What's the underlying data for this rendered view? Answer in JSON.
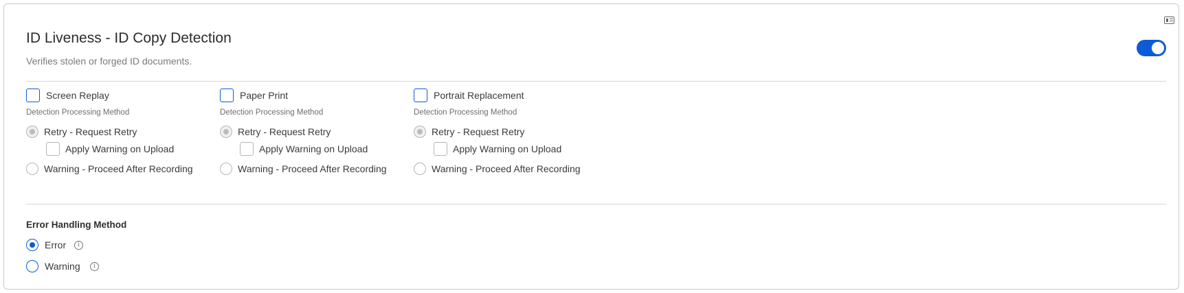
{
  "card": {
    "title": "ID Liveness - ID Copy Detection",
    "subtitle": "Verifies stolen or forged ID documents.",
    "enabled": true,
    "icon": "id-card-icon"
  },
  "detections": [
    {
      "label": "Screen Replay",
      "checked": false,
      "method_label": "Detection Processing Method",
      "retry_label": "Retry - Request Retry",
      "apply_warning_label": "Apply Warning on Upload",
      "warning_label": "Warning - Proceed After Recording"
    },
    {
      "label": "Paper Print",
      "checked": false,
      "method_label": "Detection Processing Method",
      "retry_label": "Retry - Request Retry",
      "apply_warning_label": "Apply Warning on Upload",
      "warning_label": "Warning - Proceed After Recording"
    },
    {
      "label": "Portrait Replacement",
      "checked": false,
      "method_label": "Detection Processing Method",
      "retry_label": "Retry - Request Retry",
      "apply_warning_label": "Apply Warning on Upload",
      "warning_label": "Warning - Proceed After Recording"
    }
  ],
  "error_handling": {
    "title": "Error Handling Method",
    "options": [
      {
        "label": "Error",
        "selected": true,
        "info_icon": "i"
      },
      {
        "label": "Warning",
        "selected": false,
        "info_icon": "i"
      }
    ]
  },
  "colors": {
    "accent": "#0b5bd7",
    "border": "#c9c9c9",
    "disabled": "#b5b5b5"
  }
}
